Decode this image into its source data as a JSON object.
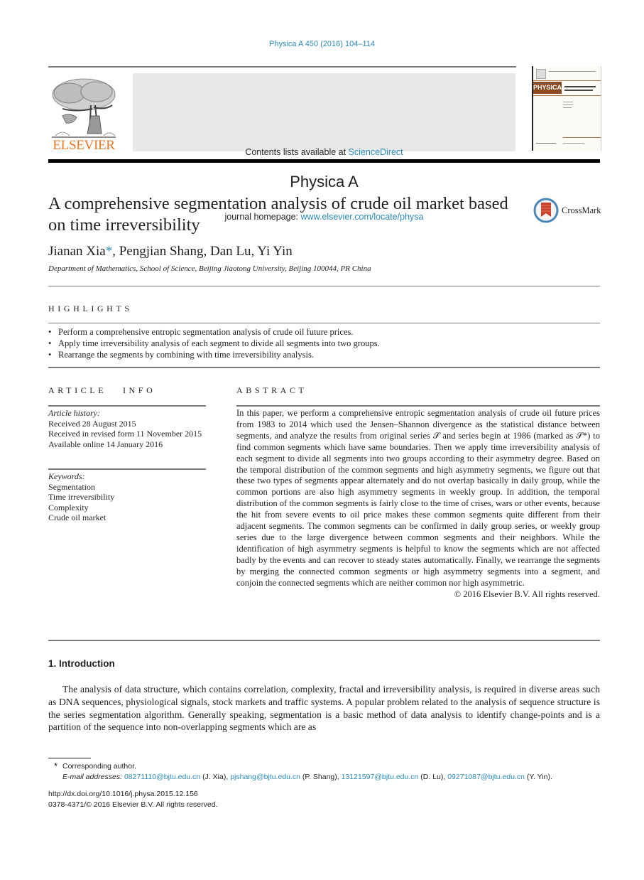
{
  "header": {
    "citation": "Physica A 450 (2016) 104–114",
    "publisher_logo_label": "ELSEVIER",
    "contents_prefix": "Contents lists available at ",
    "contents_link": "ScienceDirect",
    "journal_name": "Physica A",
    "homepage_prefix": "journal homepage: ",
    "homepage_link": "www.elsevier.com/locate/physa",
    "cover_title": "PHYSICA"
  },
  "article": {
    "title": "A comprehensive segmentation analysis of crude oil market based on time irreversibility",
    "crossmark_label": "CrossMark",
    "authors": [
      {
        "name": "Jianan Xia",
        "corresponding": true,
        "marker": "*"
      },
      {
        "name": "Pengjian Shang"
      },
      {
        "name": "Dan Lu"
      },
      {
        "name": "Yi Yin"
      }
    ],
    "author_separator": ", ",
    "affiliation": "Department of Mathematics, School of Science, Beijing Jiaotong University, Beijing 100044, PR China"
  },
  "highlights": {
    "heading": "HIGHLIGHTS",
    "items": [
      "Perform a comprehensive entropic segmentation analysis of crude oil future prices.",
      "Apply time irreversibility analysis of each segment to divide all segments into two groups.",
      "Rearrange the segments by combining with time irreversibility analysis."
    ]
  },
  "article_info": {
    "heading": "ARTICLE   INFO",
    "history_label": "Article history:",
    "history": [
      "Received 28 August 2015",
      "Received in revised form 11 November 2015",
      "Available online 14 January 2016"
    ],
    "keywords_label": "Keywords:",
    "keywords": [
      "Segmentation",
      "Time irreversibility",
      "Complexity",
      "Crude oil market"
    ]
  },
  "abstract": {
    "heading": "ABSTRACT",
    "text": "In this paper, we perform a comprehensive entropic segmentation analysis of crude oil future prices from 1983 to 2014 which used the Jensen–Shannon divergence as the statistical distance between segments, and analyze the results from original series 𝒮 and series begin at 1986 (marked as 𝒮*) to find common segments which have same boundaries. Then we apply time irreversibility analysis of each segment to divide all segments into two groups according to their asymmetry degree. Based on the temporal distribution of the common segments and high asymmetry segments, we figure out that these two types of segments appear alternately and do not overlap basically in daily group, while the common portions are also high asymmetry segments in weekly group. In addition, the temporal distribution of the common segments is fairly close to the time of crises, wars or other events, because the hit from severe events to oil price makes these common segments quite different from their adjacent segments. The common segments can be confirmed in daily group series, or weekly group series due to the large divergence between common segments and their neighbors. While the identification of high asymmetry segments is helpful to know the segments which are not affected badly by the events and can recover to steady states automatically. Finally, we rearrange the segments by merging the connected common segments or high asymmetry segments into a segment, and conjoin the connected segments which are neither common nor high asymmetric.",
    "copyright": "© 2016 Elsevier B.V. All rights reserved."
  },
  "introduction": {
    "heading": "1.  Introduction",
    "text": "The analysis of data structure, which contains correlation, complexity, fractal and irreversibility analysis, is required in diverse areas such as DNA sequences, physiological signals, stock markets and traffic systems. A popular problem related to the analysis of sequence structure is the series segmentation algorithm. Generally speaking, segmentation is a basic method of data analysis to identify change-points and is a partition of the sequence into non-overlapping segments which are as"
  },
  "footnotes": {
    "marker": "*",
    "corresponding": "Corresponding author.",
    "email_label": "E-mail addresses:",
    "emails": [
      {
        "address": "08271110@bjtu.edu.cn",
        "who": "(J. Xia)"
      },
      {
        "address": "pjshang@bjtu.edu.cn",
        "who": "(P. Shang)"
      },
      {
        "address": "13121597@bjtu.edu.cn",
        "who": "(D. Lu)"
      },
      {
        "address": "09271087@bjtu.edu.cn",
        "who": "(Y. Yin)."
      }
    ],
    "doi": "http://dx.doi.org/10.1016/j.physa.2015.12.156",
    "issn_line": "0378-4371/© 2016 Elsevier B.V. All rights reserved."
  }
}
